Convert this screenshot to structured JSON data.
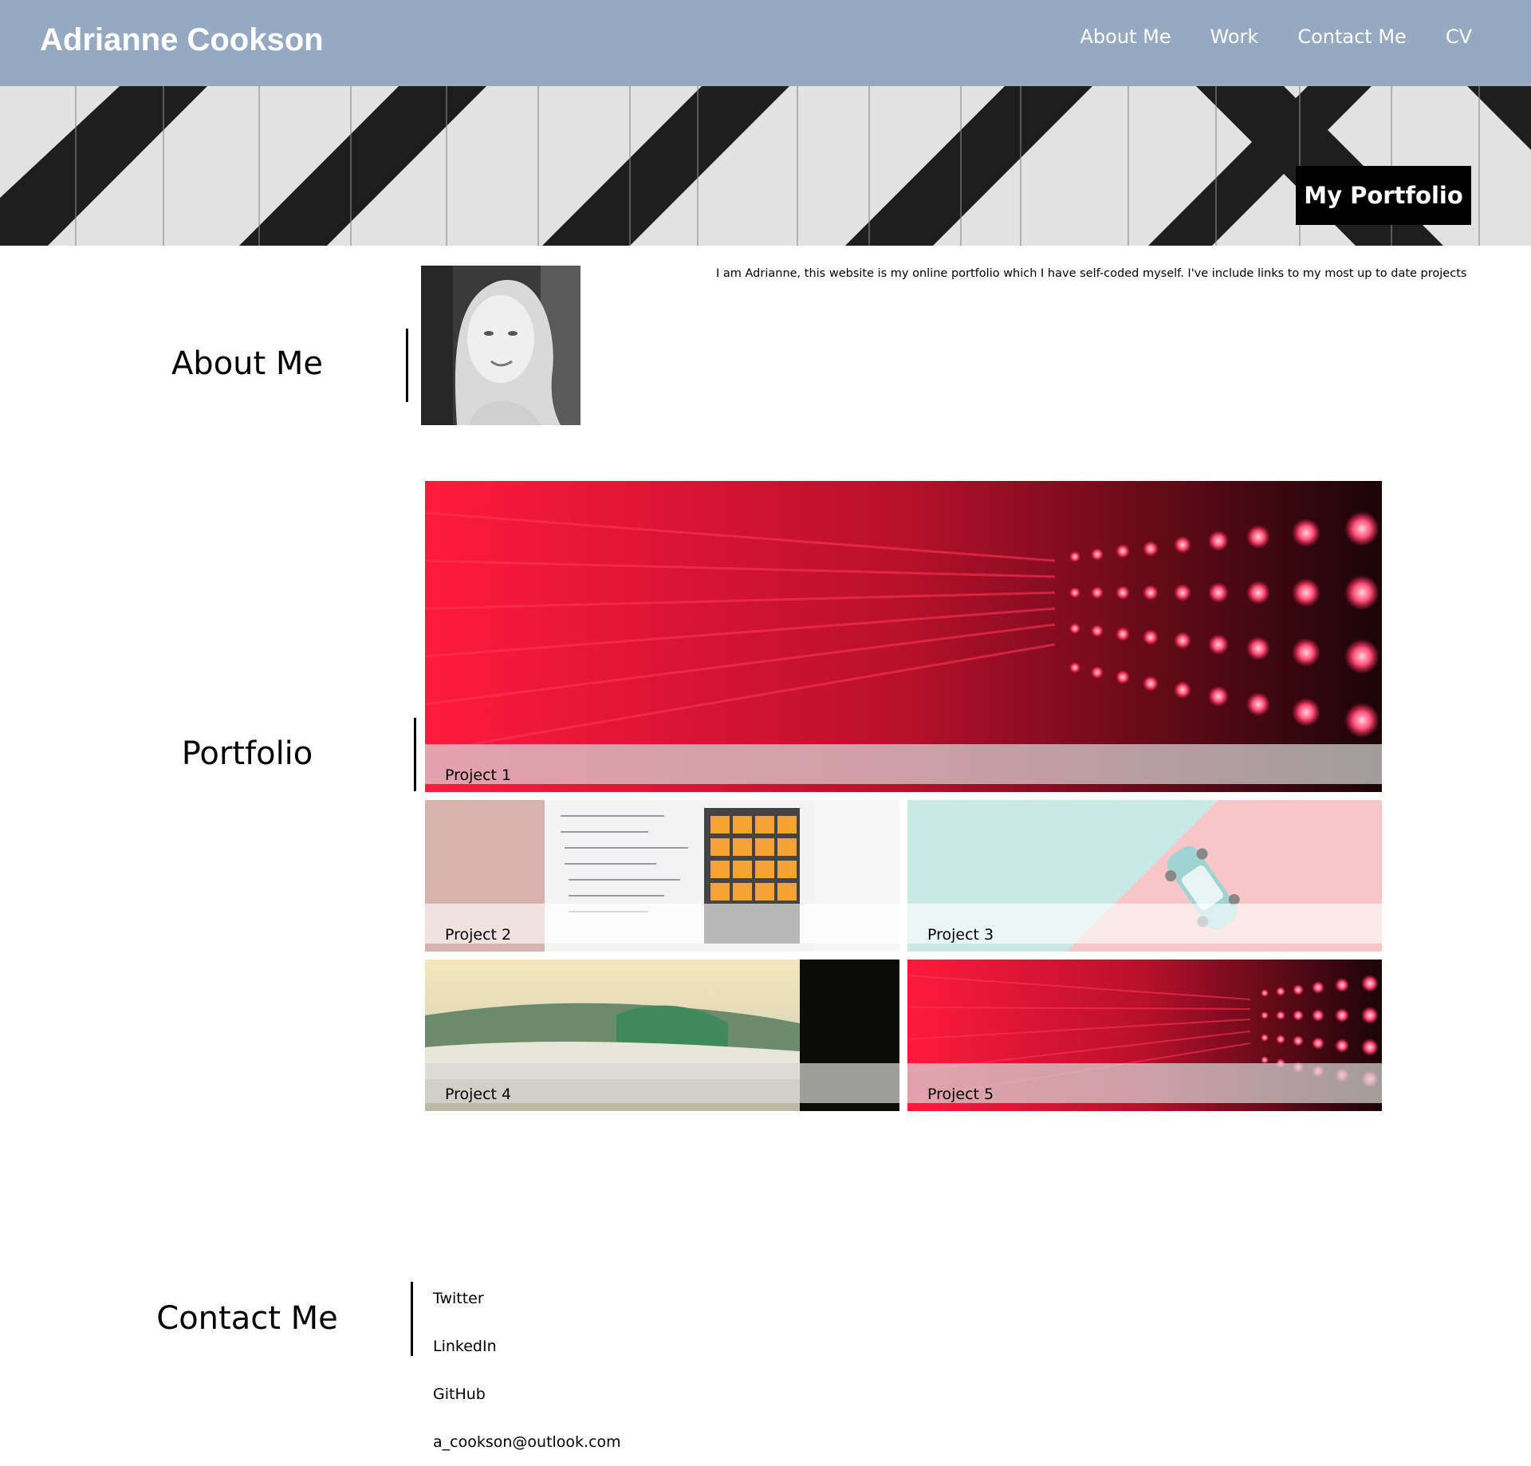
{
  "header": {
    "brand": "Adrianne Cookson",
    "nav": [
      "About Me",
      "Work",
      "Contact Me",
      "CV"
    ]
  },
  "hero": {
    "badge": "My Portfolio"
  },
  "about": {
    "title": "About Me",
    "text": "I am Adrianne, this website is my online portfolio which I have self-coded myself. I've include links to my most up to date projects"
  },
  "portfolio": {
    "title": "Portfolio",
    "projects": [
      "Project 1",
      "Project 2",
      "Project 3",
      "Project 4",
      "Project 5"
    ]
  },
  "contact": {
    "title": "Contact Me",
    "links": [
      "Twitter",
      "LinkedIn",
      "GitHub",
      "a_cookson@outlook.com"
    ]
  },
  "colors": {
    "header_bg": "#96a9c3",
    "badge_bg": "#000000",
    "text": "#000000"
  }
}
